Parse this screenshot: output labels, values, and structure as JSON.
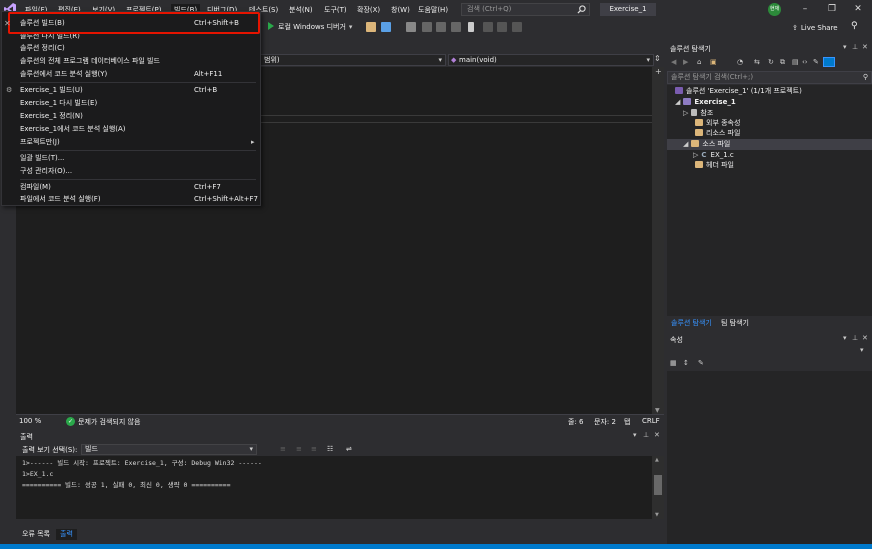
{
  "titlebar": {
    "menus": [
      "파일(F)",
      "편집(E)",
      "보기(V)",
      "프로젝트(P)",
      "빌드(B)",
      "디버그(D)",
      "테스트(S)",
      "분석(N)",
      "도구(T)",
      "확장(X)",
      "창(W)",
      "도움말(H)"
    ],
    "search_placeholder": "검색 (Ctrl+Q)",
    "solution_name": "Exercise_1",
    "user_initials": "현재"
  },
  "toolbar": {
    "run_label": "로컬 Windows 디버거",
    "live_share": "Live Share"
  },
  "editor_nav": {
    "scope": "범위)",
    "function": "main(void)"
  },
  "build_menu": {
    "items": [
      {
        "label": "솔루션 빌드(B)",
        "shortcut": "Ctrl+Shift+B"
      },
      {
        "label": "솔루션 다시 빌드(R)",
        "shortcut": ""
      },
      {
        "label": "솔루션 정리(C)",
        "shortcut": ""
      },
      {
        "label": "솔루션의 전체 프로그램 데이터베이스 파일 빌드",
        "shortcut": ""
      },
      {
        "label": "솔루션에서 코드 분석 실행(Y)",
        "shortcut": "Alt+F11"
      },
      {
        "label": "Exercise_1 빌드(U)",
        "shortcut": "Ctrl+B"
      },
      {
        "label": "Exercise_1 다시 빌드(E)",
        "shortcut": ""
      },
      {
        "label": "Exercise_1 정리(N)",
        "shortcut": ""
      },
      {
        "label": "Exercise_1에서 코드 분석 실행(A)",
        "shortcut": ""
      },
      {
        "label": "프로젝트만(J)",
        "shortcut": ""
      },
      {
        "label": "일괄 빌드(T)...",
        "shortcut": ""
      },
      {
        "label": "구성 관리자(O)...",
        "shortcut": ""
      },
      {
        "label": "컴파일(M)",
        "shortcut": "Ctrl+F7"
      },
      {
        "label": "파일에서 코드 분석 실행(F)",
        "shortcut": "Ctrl+Shift+Alt+F7"
      }
    ],
    "submenu_arrow": "▸"
  },
  "editor_status": {
    "zoom": "100 %",
    "issues": "문제가 검색되지 않음",
    "line": "줄: 6",
    "col": "문자: 2",
    "tab": "탭",
    "eol": "CRLF"
  },
  "output": {
    "title": "출력",
    "show_from_label": "출력 보기 선택(S):",
    "show_from_value": "빌드",
    "lines": [
      "1>------ 빌드 시작: 프로젝트: Exercise_1, 구성: Debug Win32 ------",
      "1>EX_1.c",
      "========== 빌드: 성공 1, 실패 0, 최신 0, 생략 0 =========="
    ],
    "tabs": [
      "오류 목록",
      "출력"
    ]
  },
  "solution_explorer": {
    "title": "솔루션 탐색기",
    "search_placeholder": "솔루션 탐색기 검색(Ctrl+;)",
    "tree": [
      {
        "label": "솔루션 'Exercise_1' (1/1개 프로젝트)",
        "depth": 0,
        "icon": "solution-icon"
      },
      {
        "label": "Exercise_1",
        "depth": 1,
        "icon": "project-icon",
        "bold": true
      },
      {
        "label": "참조",
        "depth": 2,
        "icon": "references-icon"
      },
      {
        "label": "외부 종속성",
        "depth": 2,
        "icon": "folder-icon"
      },
      {
        "label": "리소스 파일",
        "depth": 2,
        "icon": "folder-icon"
      },
      {
        "label": "소스 파일",
        "depth": 2,
        "icon": "folder-icon",
        "selected": true
      },
      {
        "label": "EX_1.c",
        "depth": 3,
        "icon": "c-file-icon"
      },
      {
        "label": "헤더 파일",
        "depth": 2,
        "icon": "folder-icon"
      }
    ],
    "tabs": [
      "솔루션 탐색기",
      "팀 탐색기"
    ]
  },
  "properties": {
    "title": "속성"
  },
  "colors": {
    "accent": "#007acc",
    "highlight_border": "#e51400",
    "run_green": "#2aa84a",
    "folder": "#dcb67a"
  }
}
